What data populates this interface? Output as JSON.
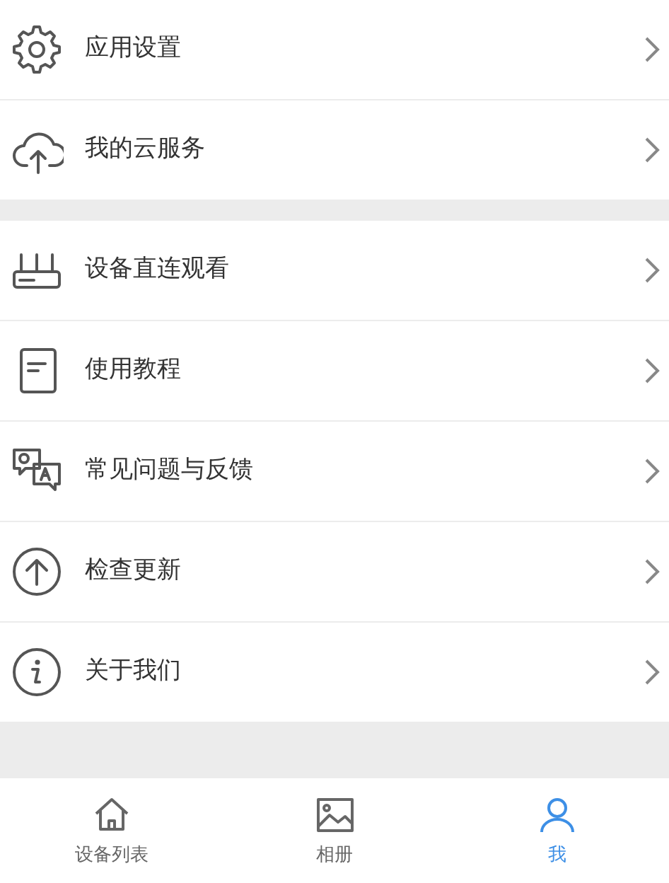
{
  "menu_groups": [
    {
      "items": [
        {
          "label": "应用设置"
        },
        {
          "label": "我的云服务"
        }
      ]
    },
    {
      "items": [
        {
          "label": "设备直连观看"
        },
        {
          "label": "使用教程"
        },
        {
          "label": "常见问题与反馈"
        },
        {
          "label": "检查更新"
        },
        {
          "label": "关于我们"
        }
      ]
    }
  ],
  "tabs": [
    {
      "label": "设备列表",
      "selected": false
    },
    {
      "label": "相册",
      "selected": false
    },
    {
      "label": "我",
      "selected": true
    }
  ]
}
